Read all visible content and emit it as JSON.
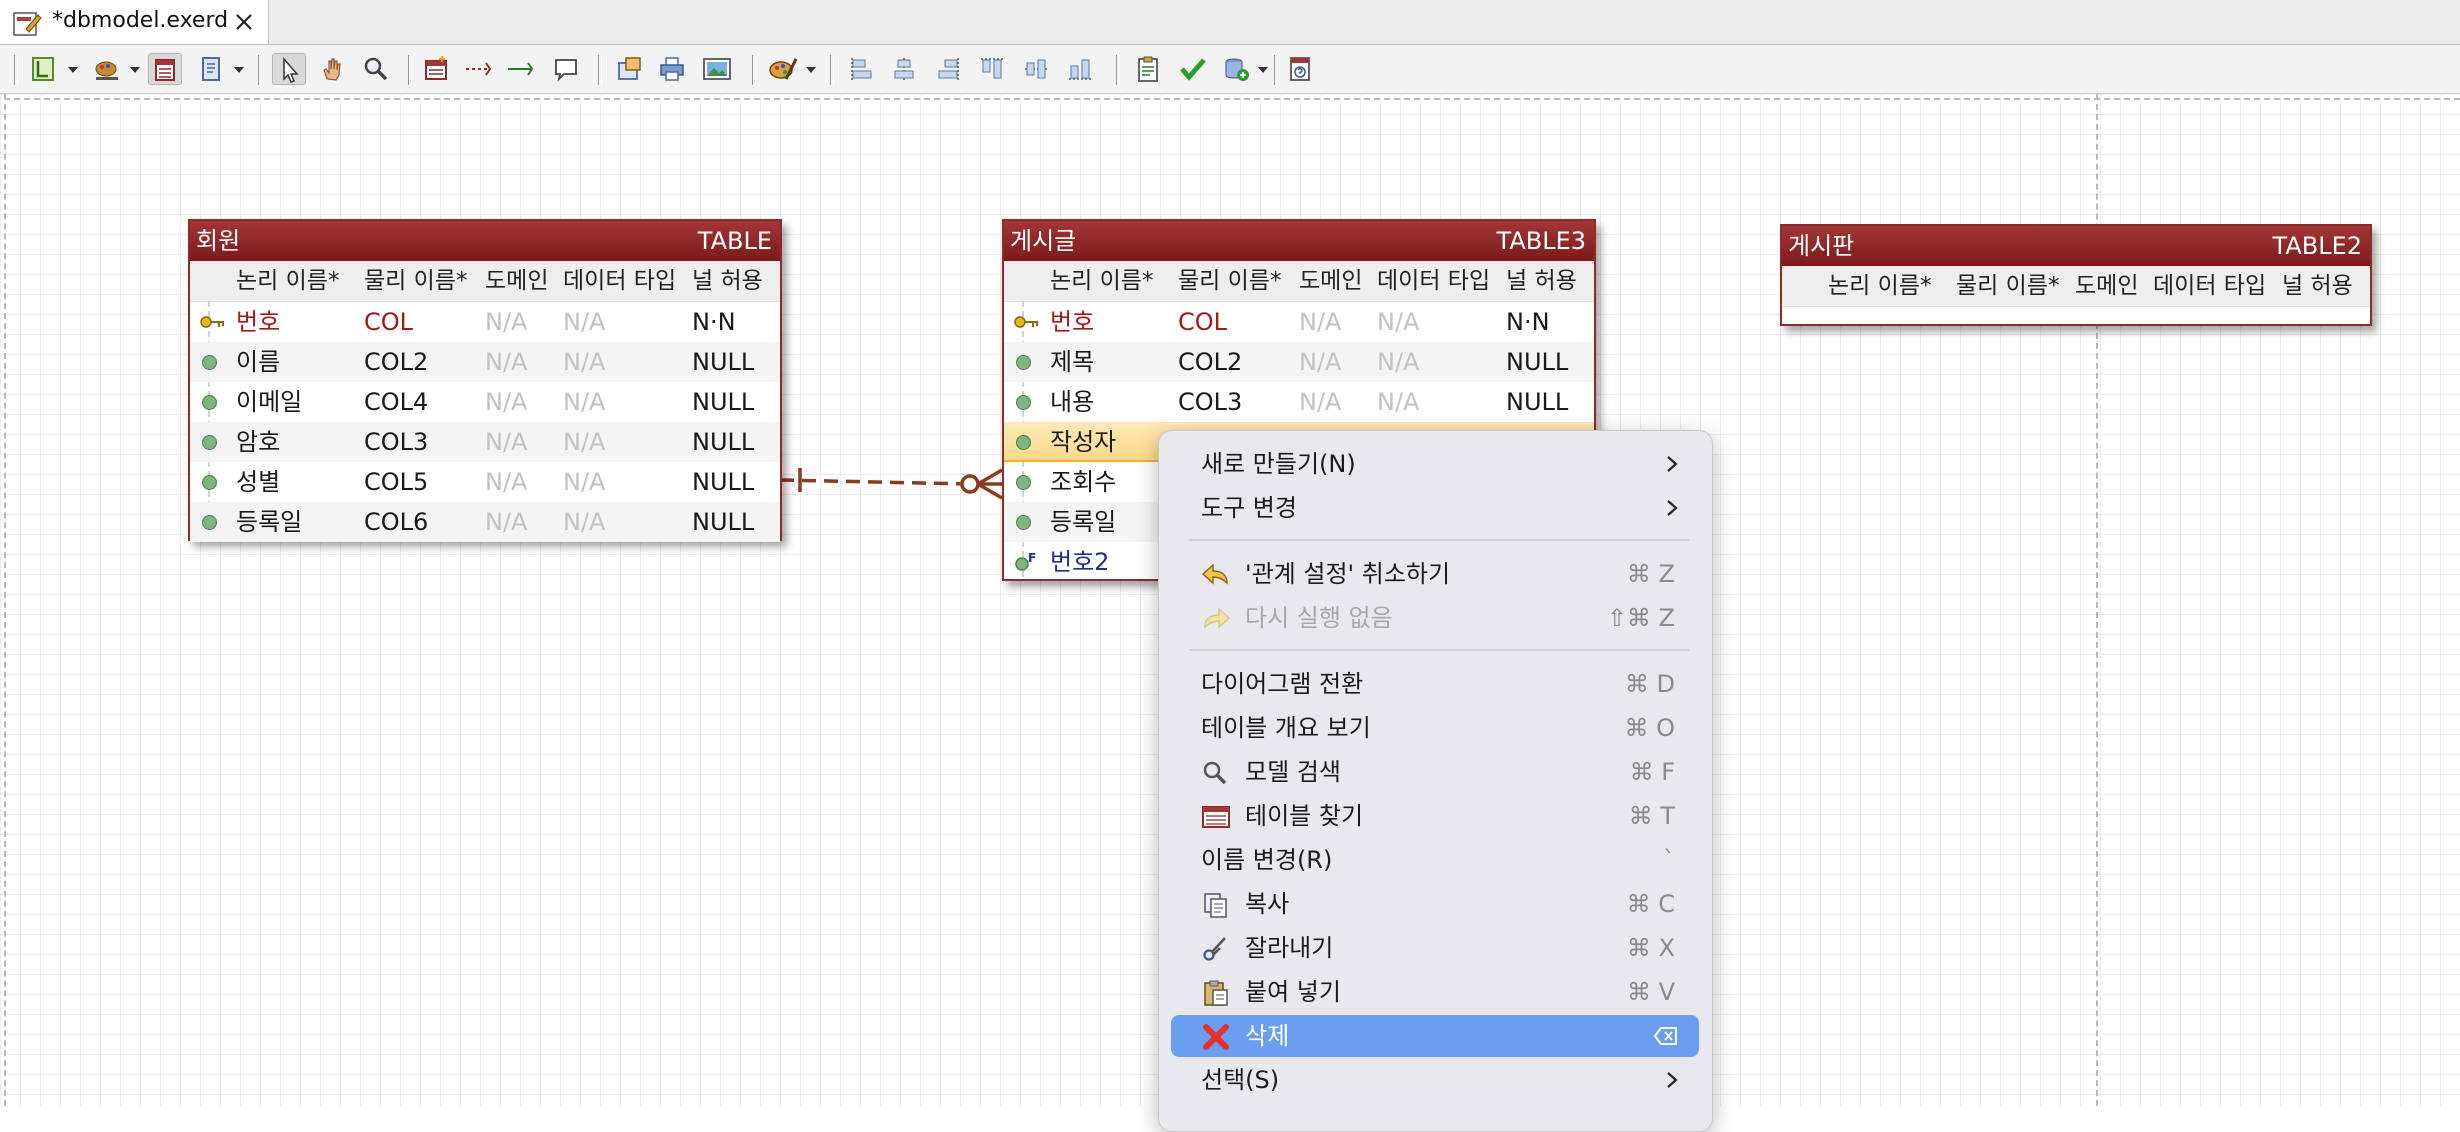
{
  "tab": {
    "title": "*dbmodel.exerd"
  },
  "entities": {
    "member": {
      "name": "회원",
      "type": "TABLE",
      "columns": [
        "논리 이름*",
        "물리 이름*",
        "도메인",
        "데이터 타입",
        "널 허용"
      ],
      "rows": [
        {
          "logical": "번호",
          "physical": "COL",
          "domain": "N/A",
          "datatype": "N/A",
          "nullable": "N·N"
        },
        {
          "logical": "이름",
          "physical": "COL2",
          "domain": "N/A",
          "datatype": "N/A",
          "nullable": "NULL"
        },
        {
          "logical": "이메일",
          "physical": "COL4",
          "domain": "N/A",
          "datatype": "N/A",
          "nullable": "NULL"
        },
        {
          "logical": "암호",
          "physical": "COL3",
          "domain": "N/A",
          "datatype": "N/A",
          "nullable": "NULL"
        },
        {
          "logical": "성별",
          "physical": "COL5",
          "domain": "N/A",
          "datatype": "N/A",
          "nullable": "NULL"
        },
        {
          "logical": "등록일",
          "physical": "COL6",
          "domain": "N/A",
          "datatype": "N/A",
          "nullable": "NULL"
        }
      ]
    },
    "post": {
      "name": "게시글",
      "type": "TABLE3",
      "columns": [
        "논리 이름*",
        "물리 이름*",
        "도메인",
        "데이터 타입",
        "널 허용"
      ],
      "rows": [
        {
          "logical": "번호",
          "physical": "COL",
          "domain": "N/A",
          "datatype": "N/A",
          "nullable": "N·N"
        },
        {
          "logical": "제목",
          "physical": "COL2",
          "domain": "N/A",
          "datatype": "N/A",
          "nullable": "NULL"
        },
        {
          "logical": "내용",
          "physical": "COL3",
          "domain": "N/A",
          "datatype": "N/A",
          "nullable": "NULL"
        },
        {
          "logical": "작성자"
        },
        {
          "logical": "조회수"
        },
        {
          "logical": "등록일"
        },
        {
          "logical": "번호2"
        }
      ]
    },
    "board": {
      "name": "게시판",
      "type": "TABLE2",
      "columns": [
        "논리 이름*",
        "물리 이름*",
        "도메인",
        "데이터 타입",
        "널 허용"
      ]
    }
  },
  "context_menu": {
    "items": [
      {
        "label": "새로 만들기(N)"
      },
      {
        "label": "도구 변경"
      },
      {
        "label": "'관계 설정' 취소하기",
        "shortcut": "⌘ Z"
      },
      {
        "label": "다시 실행 없음",
        "shortcut": "⇧⌘ Z"
      },
      {
        "label": "다이어그램 전환",
        "shortcut": "⌘ D"
      },
      {
        "label": "테이블 개요 보기",
        "shortcut": "⌘ O"
      },
      {
        "label": "모델 검색",
        "shortcut": "⌘ F"
      },
      {
        "label": "테이블 찾기",
        "shortcut": "⌘ T"
      },
      {
        "label": "이름 변경(R)",
        "shortcut": "`"
      },
      {
        "label": "복사",
        "shortcut": "⌘ C"
      },
      {
        "label": "잘라내기",
        "shortcut": "⌘ X"
      },
      {
        "label": "붙여 넣기",
        "shortcut": "⌘ V"
      },
      {
        "label": "삭제"
      },
      {
        "label": "선택(S)"
      }
    ]
  },
  "colors": {
    "entity_header": "#8e2a2a",
    "relationship_line": "#8b3a1f",
    "menu_highlight": "#6a9ef0",
    "row_highlight": "#ffd98a"
  }
}
